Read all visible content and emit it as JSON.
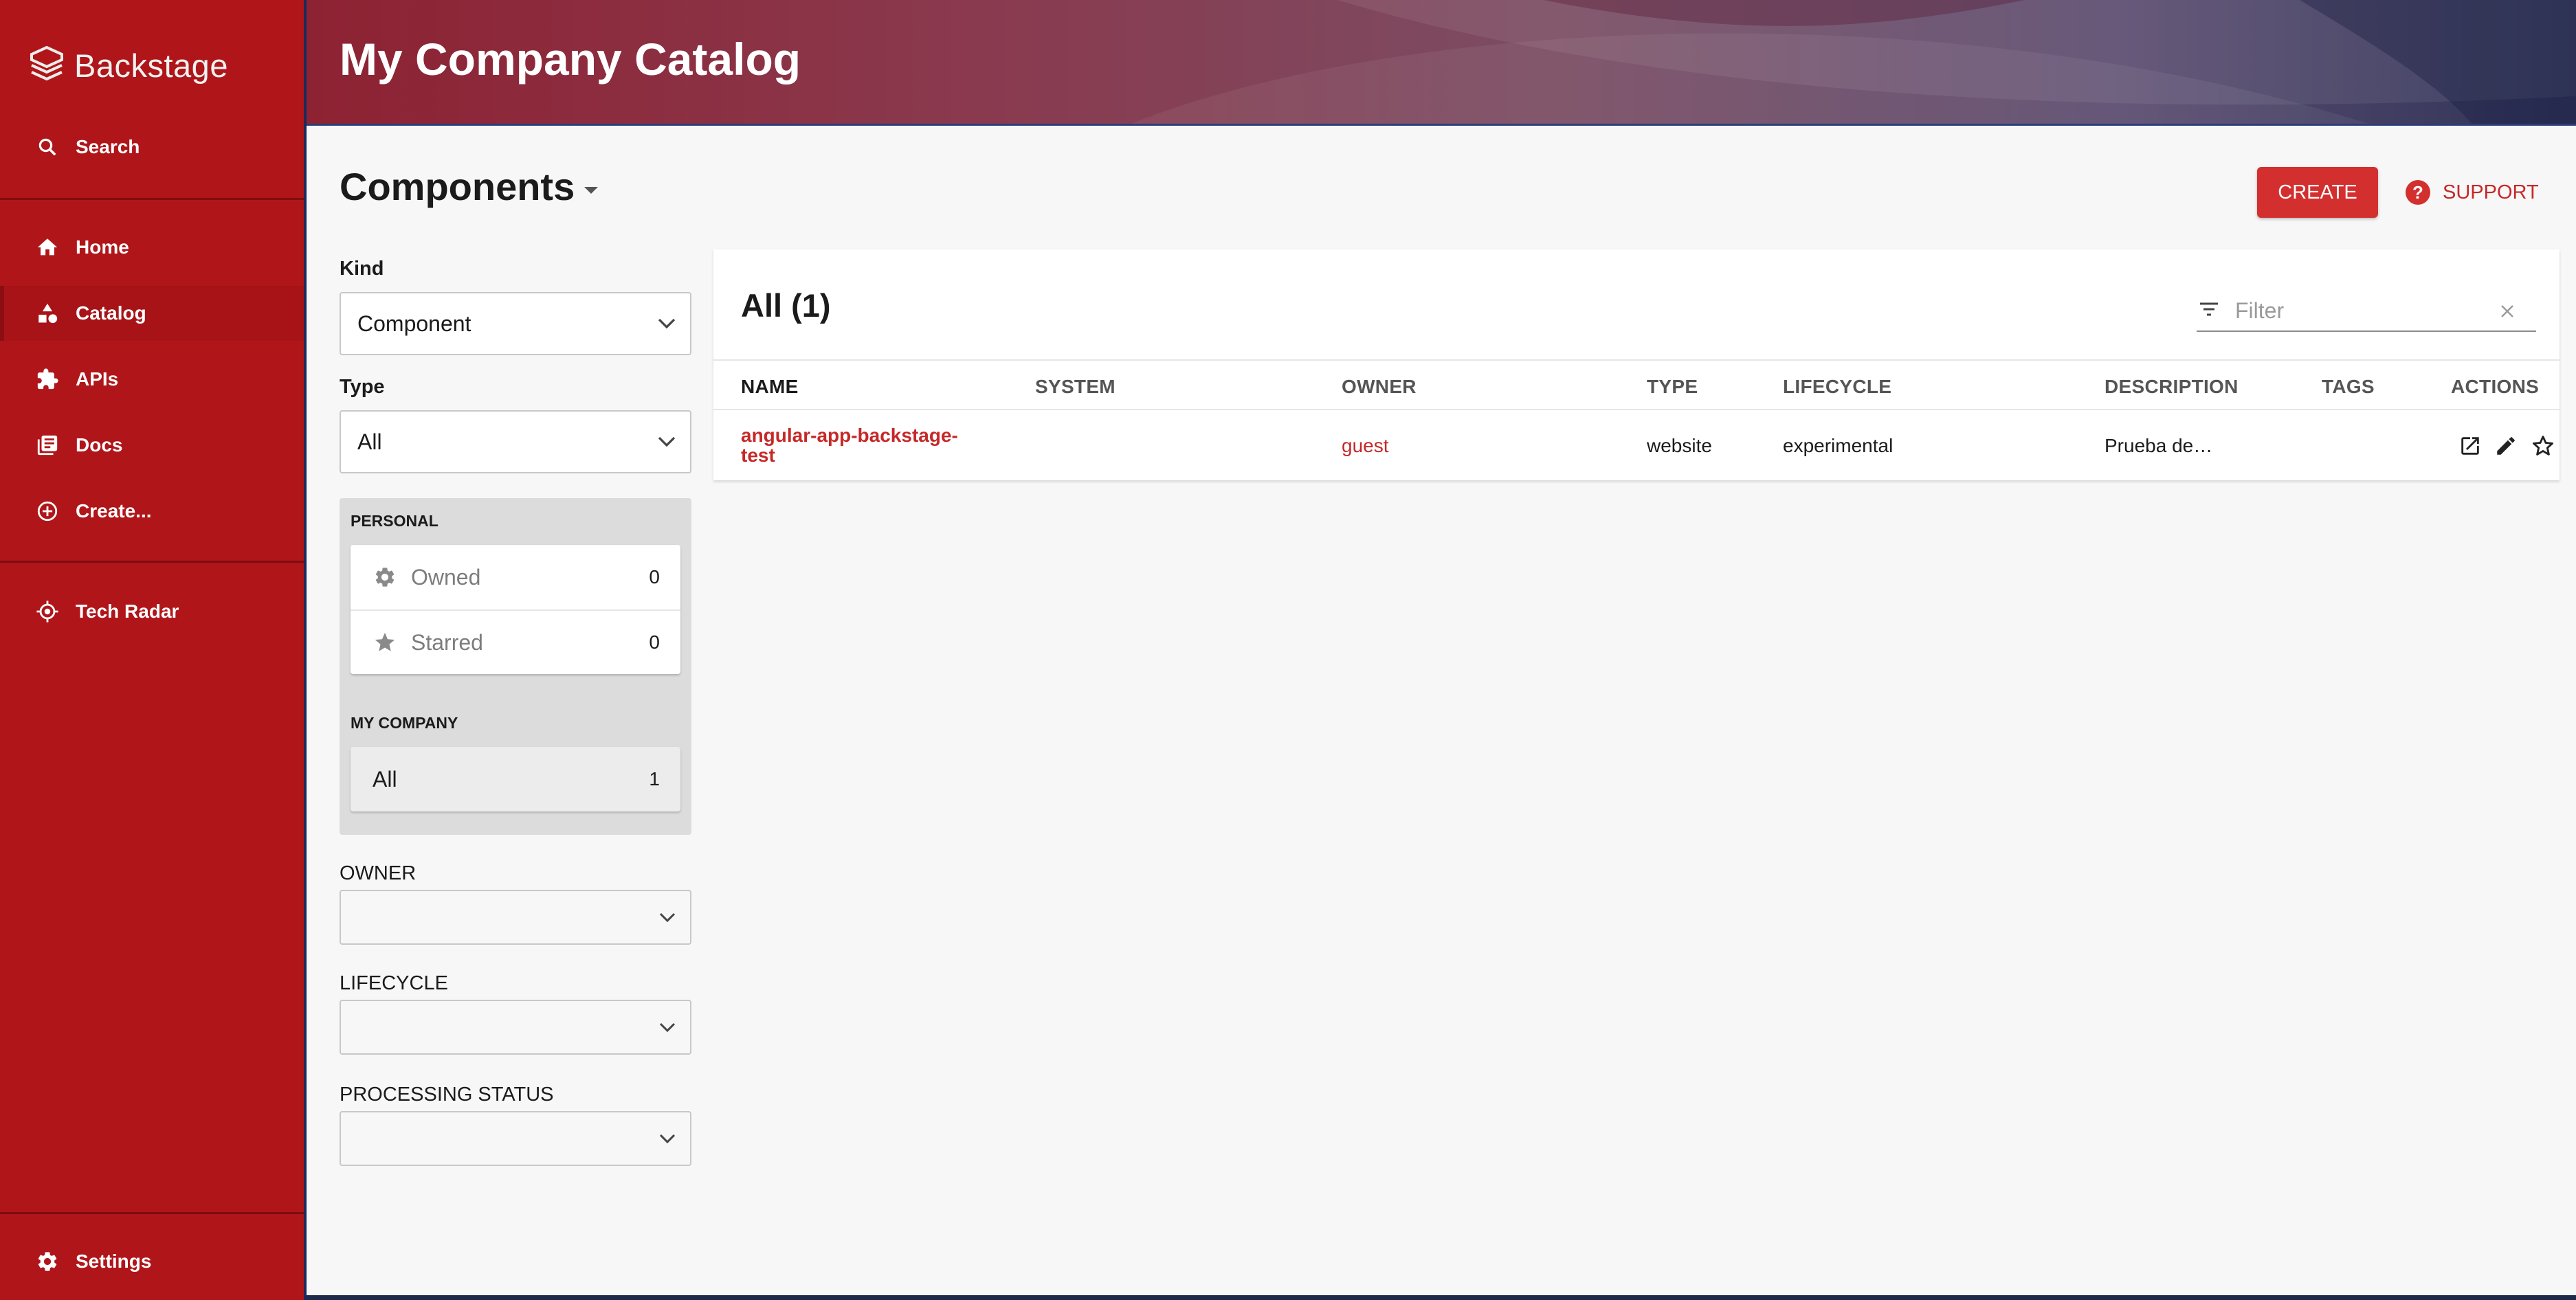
{
  "app": {
    "brand": "Backstage"
  },
  "sidebar": {
    "items": [
      {
        "label": "Search",
        "icon": "search-icon"
      },
      {
        "label": "Home",
        "icon": "home-icon"
      },
      {
        "label": "Catalog",
        "icon": "catalog-icon"
      },
      {
        "label": "APIs",
        "icon": "puzzle-icon"
      },
      {
        "label": "Docs",
        "icon": "docs-icon"
      },
      {
        "label": "Create...",
        "icon": "add-circle-icon"
      },
      {
        "label": "Tech Radar",
        "icon": "radar-icon"
      },
      {
        "label": "Settings",
        "icon": "gear-icon"
      }
    ],
    "active": "Catalog"
  },
  "header": {
    "title": "My Company Catalog"
  },
  "page": {
    "title": "Components",
    "create_label": "CREATE",
    "support_label": "SUPPORT"
  },
  "filters": {
    "kind_label": "Kind",
    "kind_value": "Component",
    "type_label": "Type",
    "type_value": "All",
    "personal_label": "PERSONAL",
    "owned_label": "Owned",
    "owned_count": "0",
    "starred_label": "Starred",
    "starred_count": "0",
    "company_label": "MY COMPANY",
    "all_label": "All",
    "all_count": "1",
    "owner_label": "OWNER",
    "lifecycle_label": "LIFECYCLE",
    "processing_label": "PROCESSING STATUS"
  },
  "table": {
    "title": "All (1)",
    "filter_placeholder": "Filter",
    "columns": [
      "NAME",
      "SYSTEM",
      "OWNER",
      "TYPE",
      "LIFECYCLE",
      "DESCRIPTION",
      "TAGS",
      "ACTIONS"
    ],
    "rows": [
      {
        "name_line1": "angular-app-backstage-",
        "name_line2": "test",
        "system": "",
        "owner": "guest",
        "type": "website",
        "lifecycle": "experimental",
        "description": "Prueba de…",
        "tags": ""
      }
    ]
  }
}
